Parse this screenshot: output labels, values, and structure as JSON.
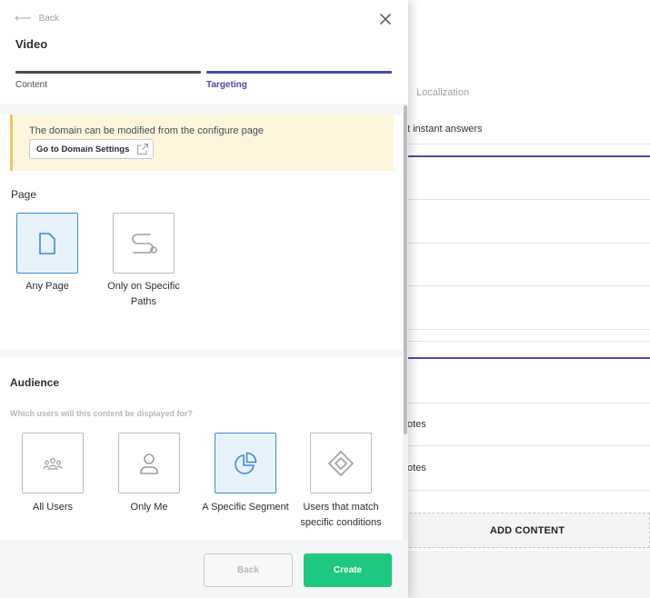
{
  "panel": {
    "back_label": "Back",
    "title": "Video",
    "steps": [
      {
        "label": "Content",
        "active": false
      },
      {
        "label": "Targeting",
        "active": true
      }
    ]
  },
  "notice": {
    "text": "The domain can be modified from the configure page",
    "button_label": "Go to Domain Settings",
    "button_icon": "external-link-icon"
  },
  "page_section": {
    "label": "Page",
    "options": [
      {
        "label": "Any Page",
        "icon": "page-icon",
        "selected": true
      },
      {
        "label": "Only on Specific Paths",
        "icon": "path-icon",
        "selected": false
      }
    ]
  },
  "audience_section": {
    "title": "Audience",
    "subtitle": "Which users will this content be displayed for?",
    "options": [
      {
        "label": "All Users",
        "icon": "users-group-icon",
        "selected": false
      },
      {
        "label": "Only Me",
        "icon": "user-icon",
        "selected": false
      },
      {
        "label": "A Specific Segment",
        "icon": "pie-chart-icon",
        "selected": true
      },
      {
        "label": "Users that match specific conditions",
        "icon": "conditions-icon",
        "selected": false
      }
    ]
  },
  "footer": {
    "back_label": "Back",
    "create_label": "Create"
  },
  "background": {
    "tab_localization": "Localization",
    "rows": [
      "t instant answers",
      "otes",
      "otes"
    ],
    "add_content_label": "ADD CONTENT"
  },
  "colors": {
    "accent_purple": "#4b4aa8",
    "create_green": "#1fc87f",
    "selected_blue": "#3b8bd6",
    "notice_bg": "#fdf6dd"
  }
}
